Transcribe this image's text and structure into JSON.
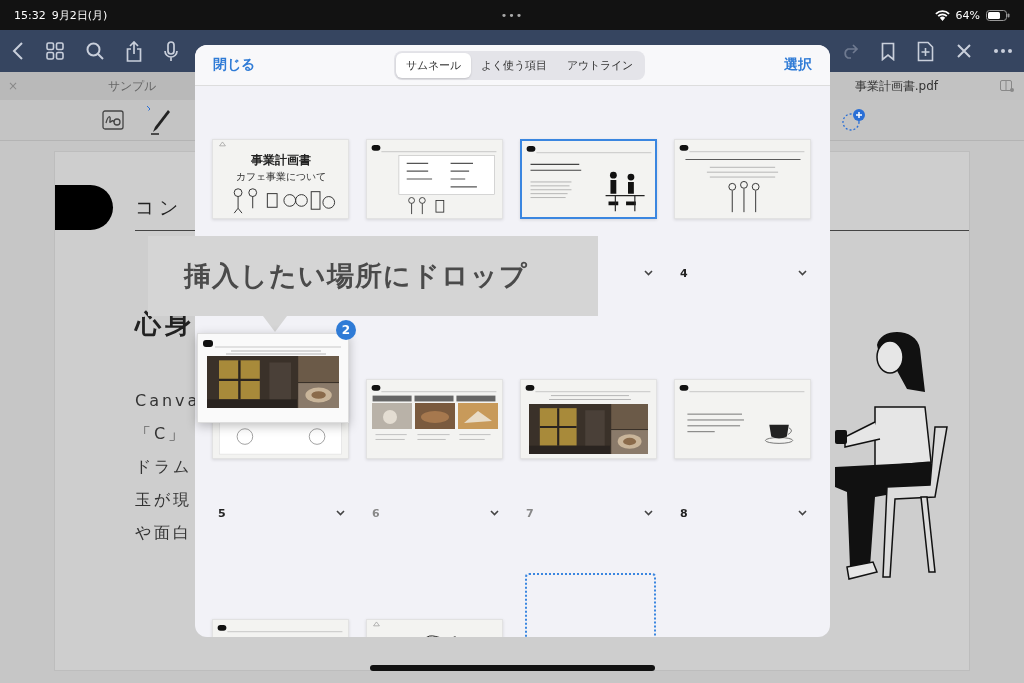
{
  "status_bar": {
    "time": "15:32",
    "date": "9月2日(月)",
    "dots": "•••",
    "battery": "64%"
  },
  "tabs": [
    {
      "label": "サンプル",
      "close": "×",
      "selected": false
    },
    {
      "label": "事業計画書.pdf",
      "selected": true
    }
  ],
  "document": {
    "heading": "コン",
    "title": "心身",
    "body": [
      "Canva",
      "「C」",
      "ドラム",
      "玉が現",
      "や面白"
    ]
  },
  "dialog": {
    "close": "閉じる",
    "select": "選択",
    "segments": [
      {
        "label": "サムネール",
        "selected": true
      },
      {
        "label": "よく使う項目",
        "selected": false
      },
      {
        "label": "アウトライン",
        "selected": false
      }
    ],
    "pages": [
      {
        "kind": "title",
        "title": "事業計画書",
        "subtitle": "カフェ事業について",
        "selected": false
      },
      {
        "kind": "agenda",
        "selected": false
      },
      {
        "kind": "concept",
        "selected": true
      },
      {
        "kind": "target",
        "number": "4",
        "dimmed": false,
        "selected": false
      },
      {
        "kind": "buttons",
        "number": "5",
        "dimmed": false,
        "selected": false
      },
      {
        "kind": "services",
        "number": "6",
        "dimmed": true,
        "selected": false
      },
      {
        "number": "7",
        "dimmed": true,
        "selected": false
      },
      {
        "kind": "coffee",
        "number": "8",
        "dimmed": false,
        "selected": false
      },
      {
        "kind": "contact",
        "selected": false
      },
      {
        "kind": "thanks",
        "selected": false
      },
      {
        "kind": "drop-slot"
      }
    ],
    "dragged": {
      "badge": "2"
    }
  },
  "caption": "挿入したい場所にドロップ"
}
